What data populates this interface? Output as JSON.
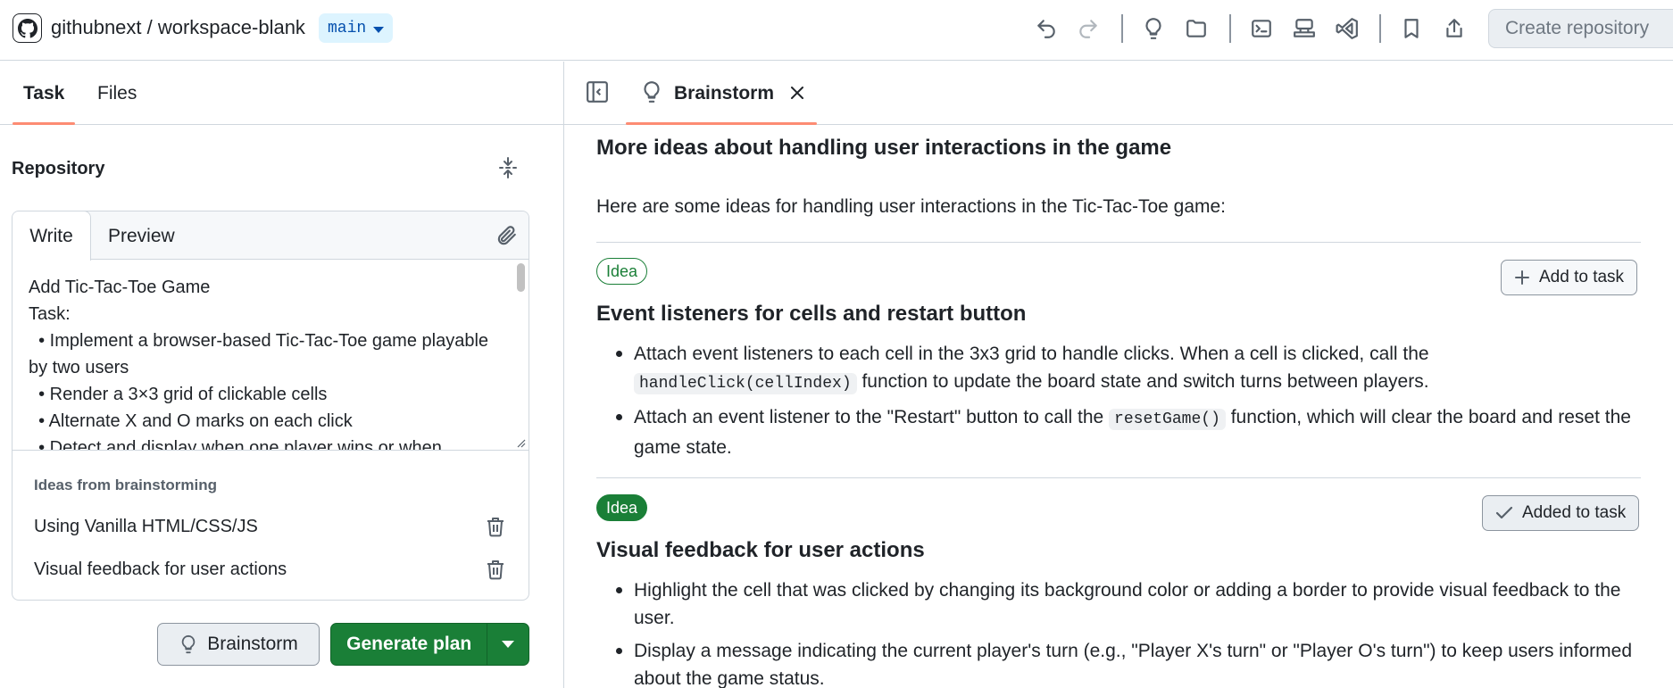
{
  "header": {
    "repo_title": "githubnext / workspace-blank",
    "branch": "main",
    "create_repo_label": "Create repository",
    "icons": [
      "github-logo-icon",
      "undo-icon",
      "redo-icon",
      "lightbulb-icon",
      "folder-icon",
      "terminal-icon",
      "server-icon",
      "vscode-icon",
      "bookmark-icon",
      "share-icon"
    ]
  },
  "left": {
    "tabs": [
      {
        "label": "Task"
      },
      {
        "label": "Files"
      }
    ],
    "repository_heading": "Repository",
    "editor": {
      "tab_write": "Write",
      "tab_preview": "Preview",
      "text": "Add Tic-Tac-Toe Game\nTask:\n  • Implement a browser-based Tic-Tac-Toe game playable by two users\n  • Render a 3×3 grid of clickable cells\n  • Alternate X and O marks on each click\n  • Detect and display when one player wins or when"
    },
    "ideas_heading": "Ideas from brainstorming",
    "ideas": [
      {
        "label": "Using Vanilla HTML/CSS/JS"
      },
      {
        "label": "Visual feedback for user actions"
      }
    ],
    "brainstorm_label": "Brainstorm",
    "generate_label": "Generate plan"
  },
  "right": {
    "tab_label": "Brainstorm",
    "heading": "More ideas about handling user interactions in the game",
    "intro": "Here are some ideas for handling user interactions in the Tic-Tac-Toe game:",
    "ideas": [
      {
        "badge": "Idea",
        "title": "Event listeners for cells and restart button",
        "action": "Add to task",
        "added": false,
        "bullets": [
          {
            "pre": "Attach event listeners to each cell in the 3x3 grid to handle clicks. When a cell is clicked, call the ",
            "code": "handleClick(cellIndex)",
            "post": " function to update the board state and switch turns between players."
          },
          {
            "pre": "Attach an event listener to the \"Restart\" button to call the ",
            "code": "resetGame()",
            "post": " function, which will clear the board and reset the game state."
          }
        ]
      },
      {
        "badge": "Idea",
        "title": "Visual feedback for user actions",
        "action": "Added to task",
        "added": true,
        "bullets": [
          {
            "pre": "Highlight the cell that was clicked by changing its background color or adding a border to provide visual feedback to the user.",
            "code": "",
            "post": ""
          },
          {
            "pre": "Display a message indicating the current player's turn (e.g., \"Player X's turn\" or \"Player O's turn\") to keep users informed about the game status.",
            "code": "",
            "post": ""
          }
        ]
      }
    ]
  }
}
